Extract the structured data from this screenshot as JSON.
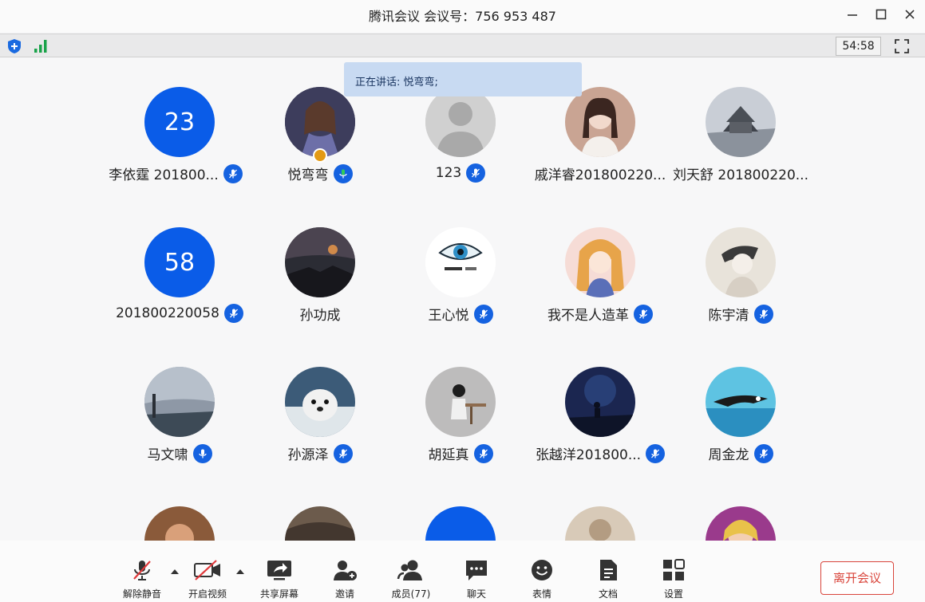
{
  "window": {
    "title": "腾讯会议 会议号：756 953 487"
  },
  "statusbar": {
    "timer": "54:58"
  },
  "speaking": "正在讲话: 悦弯弯;",
  "participants": [
    {
      "name": "李依霆 201800...",
      "avatar_text": "23",
      "mic": "muted"
    },
    {
      "name": "悦弯弯",
      "avatar_text": "",
      "mic": "active",
      "host": true
    },
    {
      "name": "123",
      "avatar_text": "",
      "mic": "muted"
    },
    {
      "name": "戚洋睿201800220...",
      "avatar_text": "",
      "mic": "none"
    },
    {
      "name": "刘天舒 201800220...",
      "avatar_text": "",
      "mic": "none"
    },
    {
      "name": "201800220058",
      "avatar_text": "58",
      "mic": "muted"
    },
    {
      "name": "孙功成",
      "avatar_text": "",
      "mic": "none"
    },
    {
      "name": "王心悦",
      "avatar_text": "",
      "mic": "muted"
    },
    {
      "name": "我不是人造革",
      "avatar_text": "",
      "mic": "muted"
    },
    {
      "name": "陈宇清",
      "avatar_text": "",
      "mic": "muted"
    },
    {
      "name": "马文啸",
      "avatar_text": "",
      "mic": "mic-on"
    },
    {
      "name": "孙源泽",
      "avatar_text": "",
      "mic": "muted"
    },
    {
      "name": "胡延真",
      "avatar_text": "",
      "mic": "muted"
    },
    {
      "name": "张越洋201800...",
      "avatar_text": "",
      "mic": "muted"
    },
    {
      "name": "周金龙",
      "avatar_text": "",
      "mic": "muted"
    }
  ],
  "toolbar": {
    "unmute": "解除静音",
    "video": "开启视频",
    "share": "共享屏幕",
    "invite": "邀请",
    "members": "成员(77)",
    "chat": "聊天",
    "reactions": "表情",
    "docs": "文档",
    "settings": "设置",
    "leave": "离开会议"
  },
  "colors": {
    "accent": "#0a5ce8",
    "leave": "#d9453b",
    "tooltip": "#c8daf2"
  }
}
